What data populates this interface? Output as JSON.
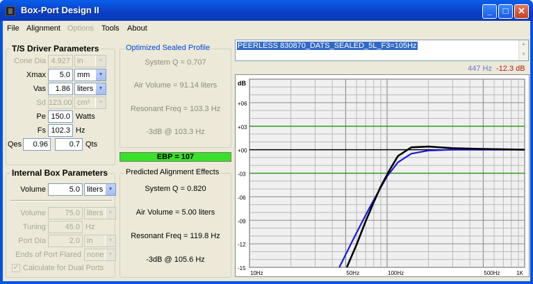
{
  "window": {
    "title": "Box-Port Design II",
    "minimize": "_",
    "maximize": "□",
    "close": "✕"
  },
  "menu": {
    "file": "File",
    "alignment": "Alignment",
    "options": "Options",
    "tools": "Tools",
    "about": "About"
  },
  "ts_params": {
    "title": "T/S Driver Parameters",
    "cone_dia": {
      "label": "Cone Dia",
      "value": "4.927",
      "unit": "in"
    },
    "xmax": {
      "label": "Xmax",
      "value": "5.0",
      "unit": "mm"
    },
    "vas": {
      "label": "Vas",
      "value": "1.86",
      "unit": "liters"
    },
    "sd": {
      "label": "Sd",
      "value": "123.005",
      "unit": "cm²"
    },
    "pe": {
      "label": "Pe",
      "value": "150.0",
      "unit": "Watts"
    },
    "fs": {
      "label": "Fs",
      "value": "102.3",
      "unit": "Hz"
    },
    "qes": {
      "label": "Qes",
      "value": "0.96"
    },
    "qts": {
      "label": "Qts",
      "value": "0.7"
    }
  },
  "optimized": {
    "title": "Optimized Sealed Profile",
    "system_q": "System Q = 0.707",
    "air_volume": "Air Volume = 91.14 liters",
    "resonant_freq": "Resonant Freq = 103.3 Hz",
    "f3": "-3dB @ 103.3 Hz"
  },
  "ebp": "EBP = 107",
  "box_params": {
    "title": "Internal Box Parameters",
    "volume": {
      "label": "Volume",
      "value": "5.0",
      "unit": "liters"
    },
    "volume2": {
      "label": "Volume",
      "value": "75.0",
      "unit": "liters"
    },
    "tuning": {
      "label": "Tuning",
      "value": "45.0",
      "unit": "Hz"
    },
    "port_dia": {
      "label": "Port Dia",
      "value": "2.0",
      "unit": "in"
    },
    "flared": {
      "label": "Ends of Port Flared",
      "value": "none"
    },
    "dual": {
      "label": "Calculate for Dual Ports",
      "check": "✓"
    }
  },
  "predicted": {
    "title": "Predicted Alignment Effects",
    "system_q": "System Q = 0.820",
    "air_volume": "Air Volume = 5.00 liters",
    "resonant_freq": "Resonant Freq = 119.8 Hz",
    "f3": "-3dB @ 105.6 Hz"
  },
  "profile_text": "PEERLESS 830870_DATS_SEALED_5L_F3=105Hz",
  "cursor": {
    "freq": "447 Hz",
    "db": "-12.3 dB"
  },
  "colors": {
    "ref_line": "#2e9a1c",
    "zero_line": "#000000",
    "optimized_curve": "#1a1ad8",
    "predicted_curve": "#000000",
    "grid": "#b8b8b8"
  },
  "chart_data": {
    "type": "line",
    "ylabel": "dB",
    "x_scale": "log",
    "xlim": [
      10,
      1000
    ],
    "ylim": [
      -15,
      9
    ],
    "y_ticks": [
      "+06",
      "+03",
      "+00",
      "-03",
      "-06",
      "-09",
      "-12",
      "-15"
    ],
    "x_ticks": [
      "10Hz",
      "50Hz",
      "100Hz",
      "500Hz",
      "1K"
    ],
    "reference_lines": [
      3,
      0,
      -3
    ],
    "series": [
      {
        "color": "#1a1ad8",
        "x": [
          45,
          55,
          65,
          75,
          85,
          100,
          120,
          150,
          200,
          300,
          500,
          1000
        ],
        "y": [
          -15,
          -11.9,
          -9.4,
          -7.3,
          -5.6,
          -3.4,
          -1.6,
          -0.5,
          -0.1,
          0.0,
          0.0,
          0.0
        ]
      },
      {
        "color": "#000000",
        "x": [
          51,
          60,
          70,
          80,
          90,
          105,
          120,
          150,
          200,
          300,
          500,
          1000
        ],
        "y": [
          -15,
          -12.1,
          -9.1,
          -6.7,
          -4.7,
          -2.5,
          -0.8,
          0.3,
          0.4,
          0.2,
          0.1,
          0.0
        ]
      }
    ]
  }
}
